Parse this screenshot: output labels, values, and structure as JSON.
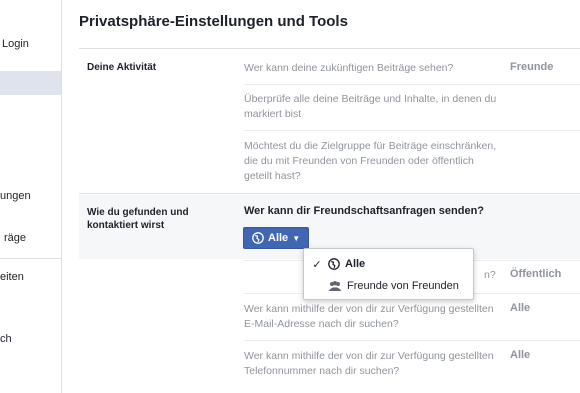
{
  "sidebar": {
    "items": [
      "Login",
      "ungen",
      "räge",
      "eiten",
      "ch"
    ]
  },
  "main": {
    "title": "Privatsphäre-Einstellungen und Tools",
    "sections": {
      "activity": {
        "label": "Deine Aktivität",
        "rows": [
          {
            "question": "Wer kann deine zukünftigen Beiträge sehen?",
            "value": "Freunde"
          },
          {
            "question": "Überprüfe alle deine Beiträge und Inhalte, in denen du markiert bist",
            "value": ""
          },
          {
            "question": "Möchtest du die Zielgruppe für Beiträge einschränken, die du mit Freunden von Freunden oder öffentlich geteilt hast?",
            "value": ""
          }
        ]
      },
      "findability": {
        "label": "Wie du gefunden und kontaktiert wirst",
        "active_question": "Wer kann dir Freundschaftsanfragen senden?",
        "audience_button": "Alle",
        "dropdown": {
          "options": [
            {
              "label": "Alle",
              "selected": true,
              "icon": "globe-icon"
            },
            {
              "label": "Freunde von Freunden",
              "selected": false,
              "icon": "friends-icon"
            }
          ]
        },
        "rows": [
          {
            "question": "n?",
            "value": "Öffentlich"
          },
          {
            "question": "Wer kann mithilfe der von dir zur Verfügung gestellten E-Mail-Adresse nach dir suchen?",
            "value": "Alle"
          },
          {
            "question": "Wer kann mithilfe der von dir zur Verfügung gestellten Telefonnummer nach dir suchen?",
            "value": "Alle"
          }
        ]
      }
    }
  },
  "colors": {
    "accent": "#4267b2",
    "muted_text": "#90949c",
    "sidebar_active": "#dfe3ee"
  }
}
